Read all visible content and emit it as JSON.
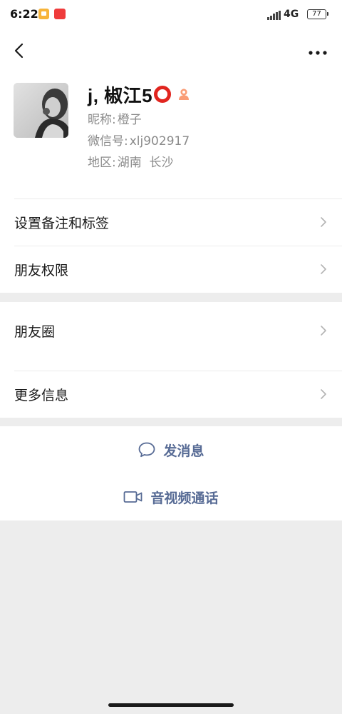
{
  "status_bar": {
    "time": "6:22",
    "network": "4G",
    "battery": "77",
    "icons": [
      "notification-icon",
      "xiaohongshu-icon",
      "signal-icon",
      "battery-icon"
    ]
  },
  "nav": {
    "back_icon": "chevron-left-icon",
    "more_icon": "more-dots-icon"
  },
  "profile": {
    "display_name": "j, 椒江5",
    "name_emoji": "red-circle",
    "gender_icon": "female-icon",
    "nickname_label": "昵称:",
    "nickname": "橙子",
    "wechat_id_label": "微信号:",
    "wechat_id": "xlj902917",
    "region_label": "地区:",
    "region": "湖南  长沙"
  },
  "settings_group": {
    "items": [
      {
        "label": "设置备注和标签"
      },
      {
        "label": "朋友权限"
      }
    ]
  },
  "info_group": {
    "items": [
      {
        "label": "朋友圈"
      },
      {
        "label": "更多信息"
      }
    ]
  },
  "actions": {
    "message": {
      "label": "发消息",
      "icon": "chat-bubble-icon"
    },
    "call": {
      "label": "音视频通话",
      "icon": "video-camera-icon"
    }
  },
  "colors": {
    "link_blue": "#576b95",
    "background": "#ededed",
    "secondary_text": "#8a8a8a",
    "red_circle": "#e1251f",
    "female_icon": "#fa9d76"
  }
}
